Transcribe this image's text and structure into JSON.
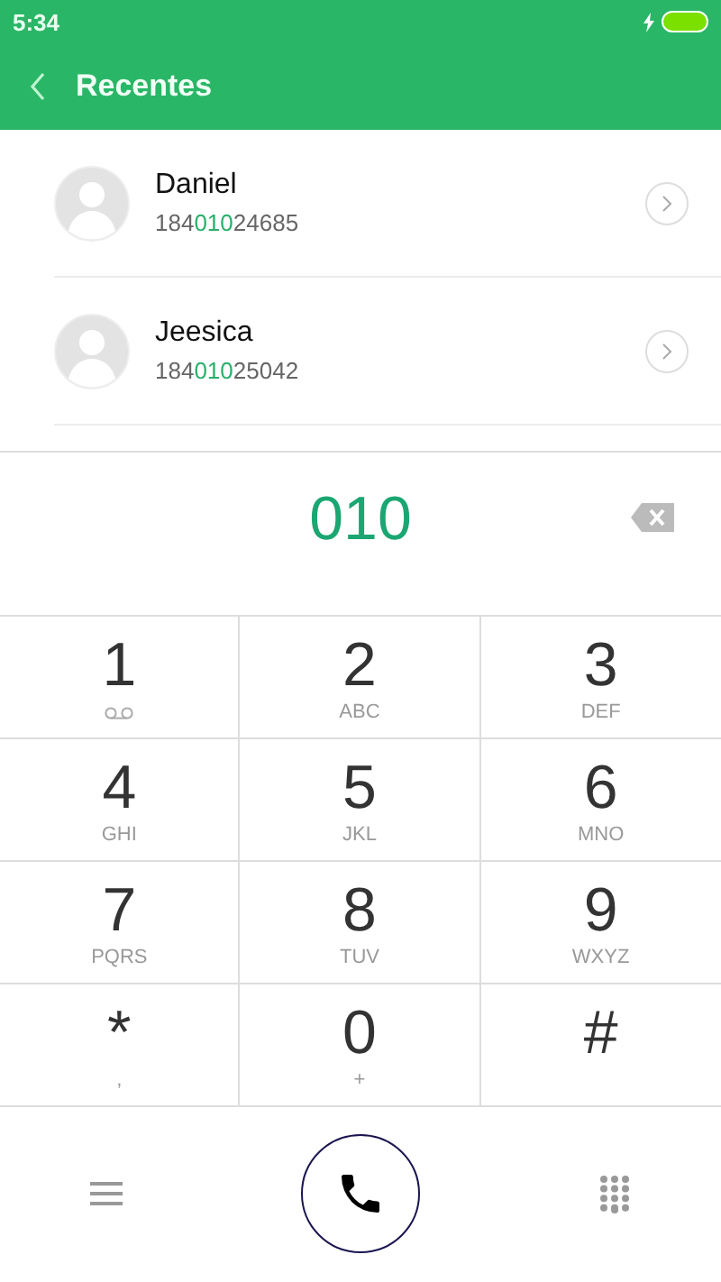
{
  "status_bar": {
    "time": "5:34",
    "charging": true
  },
  "header": {
    "title": "Recentes"
  },
  "contacts": [
    {
      "name": "Daniel",
      "number_parts": [
        {
          "text": "184",
          "highlighted": false
        },
        {
          "text": "010",
          "highlighted": true
        },
        {
          "text": "24685",
          "highlighted": false
        }
      ]
    },
    {
      "name": "Jeesica",
      "number_parts": [
        {
          "text": "184",
          "highlighted": false
        },
        {
          "text": "010",
          "highlighted": true
        },
        {
          "text": "25042",
          "highlighted": false
        }
      ]
    }
  ],
  "display": {
    "value": "010"
  },
  "keys": [
    {
      "digit": "1",
      "kind": "voicemail"
    },
    {
      "digit": "2",
      "letters": "ABC",
      "kind": "letters"
    },
    {
      "digit": "3",
      "letters": "DEF",
      "kind": "letters"
    },
    {
      "digit": "4",
      "letters": "GHI",
      "kind": "letters"
    },
    {
      "digit": "5",
      "letters": "JKL",
      "kind": "letters"
    },
    {
      "digit": "6",
      "letters": "MNO",
      "kind": "letters"
    },
    {
      "digit": "7",
      "letters": "PQRS",
      "kind": "letters"
    },
    {
      "digit": "8",
      "letters": "TUV",
      "kind": "letters"
    },
    {
      "digit": "9",
      "letters": "WXYZ",
      "kind": "letters"
    },
    {
      "digit": "*",
      "letters": ",",
      "kind": "letters"
    },
    {
      "digit": "0",
      "letters": "+",
      "kind": "letters"
    },
    {
      "digit": "#",
      "kind": "plain"
    }
  ]
}
